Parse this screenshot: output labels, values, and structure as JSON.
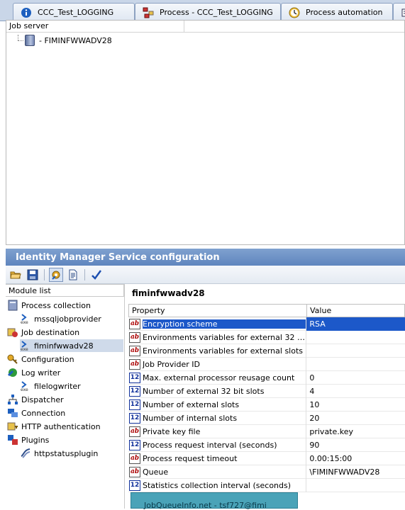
{
  "tabs": [
    {
      "label": "CCC_Test_LOGGING",
      "icon": "info-icon"
    },
    {
      "label": "Process - CCC_Test_LOGGING",
      "icon": "process-icon"
    },
    {
      "label": "Process automation",
      "icon": "clock-icon"
    }
  ],
  "jobserver": {
    "column_header": "Job server",
    "servers": [
      "- FIMINFWWADV28"
    ]
  },
  "service_config": {
    "title": "Identity Manager Service configuration"
  },
  "module_list": {
    "header": "Module list",
    "items": [
      {
        "label": "Process collection",
        "icon": "server-icon"
      },
      {
        "label": "mssqljobprovider",
        "icon": "exe-icon"
      },
      {
        "label": "Job destination",
        "icon": "jobdest-icon"
      },
      {
        "label": "fiminfwwadv28",
        "icon": "exe-icon"
      },
      {
        "label": "Configuration",
        "icon": "key-icon"
      },
      {
        "label": "Log writer",
        "icon": "logwriter-icon"
      },
      {
        "label": "filelogwriter",
        "icon": "exe-icon"
      },
      {
        "label": "Dispatcher",
        "icon": "dispatcher-icon"
      },
      {
        "label": "Connection",
        "icon": "connection-icon"
      },
      {
        "label": "HTTP authentication",
        "icon": "http-auth-icon"
      },
      {
        "label": "Plugins",
        "icon": "plugins-icon"
      },
      {
        "label": "httpstatusplugin",
        "icon": "plugin-icon"
      }
    ],
    "selected": "fiminfwwadv28"
  },
  "detail": {
    "title": "fiminfwwadv28",
    "columns": [
      "Property",
      "Value"
    ],
    "rows": [
      {
        "type": "ab",
        "property": "Encryption scheme",
        "value": "RSA"
      },
      {
        "type": "ab",
        "property": "Environments variables for external 32 bit s...",
        "value": ""
      },
      {
        "type": "ab",
        "property": "Environments variables for external slots",
        "value": ""
      },
      {
        "type": "ab",
        "property": "Job Provider ID",
        "value": ""
      },
      {
        "type": "12",
        "property": "Max. external processor reusage count",
        "value": "0"
      },
      {
        "type": "12",
        "property": "Number of external 32 bit slots",
        "value": "4"
      },
      {
        "type": "12",
        "property": "Number of external slots",
        "value": "10"
      },
      {
        "type": "12",
        "property": "Number of internal slots",
        "value": "20"
      },
      {
        "type": "ab",
        "property": "Private key file",
        "value": "private.key"
      },
      {
        "type": "12",
        "property": "Process request interval (seconds)",
        "value": "90"
      },
      {
        "type": "ab",
        "property": "Process request timeout",
        "value": "0.00:15:00"
      },
      {
        "type": "ab",
        "property": "Queue",
        "value": "\\FIMINFWWADV28"
      },
      {
        "type": "12",
        "property": "Statistics collection interval (seconds)",
        "value": ""
      }
    ]
  },
  "popup": {
    "text": "JobQueueInfo.net - tsf727@fimi"
  }
}
